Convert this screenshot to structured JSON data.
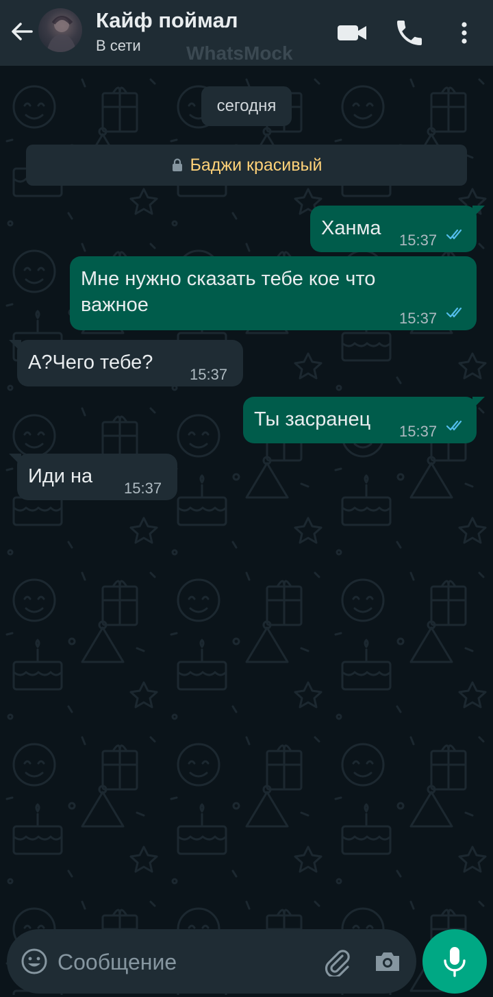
{
  "header": {
    "title": "Кайф поймал",
    "status": "В сети",
    "watermark": "WhatsMock"
  },
  "chat": {
    "date_chip": "сегодня",
    "notice": "Баджи красивый",
    "messages": [
      {
        "direction": "outgoing",
        "text": "Ханма",
        "time": "15:37",
        "read": true
      },
      {
        "direction": "outgoing",
        "text_line1": "Мне нужно сказать тебе кое что",
        "text_line2": "важное",
        "time": "15:37",
        "read": true
      },
      {
        "direction": "incoming",
        "text": "А?Чего тебе?",
        "time": "15:37"
      },
      {
        "direction": "outgoing",
        "text": "Ты засранец",
        "time": "15:37",
        "read": true
      },
      {
        "direction": "incoming",
        "text": "Иди на",
        "time": "15:37"
      }
    ]
  },
  "composer": {
    "placeholder": "Сообщение",
    "value": ""
  },
  "icons": {
    "back": "arrow-left-icon",
    "video": "video-camera-icon",
    "call": "phone-icon",
    "menu": "more-vertical-icon",
    "emoji": "emoji-icon",
    "attach": "paperclip-icon",
    "camera": "camera-icon",
    "mic": "microphone-icon",
    "lock": "lock-icon",
    "read_receipt": "double-check-icon"
  },
  "colors": {
    "background": "#0b141a",
    "header": "#1f2c34",
    "outgoing_bubble": "#005c4b",
    "incoming_bubble": "#1f2c34",
    "accent": "#00a884",
    "notice_text": "#ffd279",
    "read_tick": "#53bdeb"
  }
}
